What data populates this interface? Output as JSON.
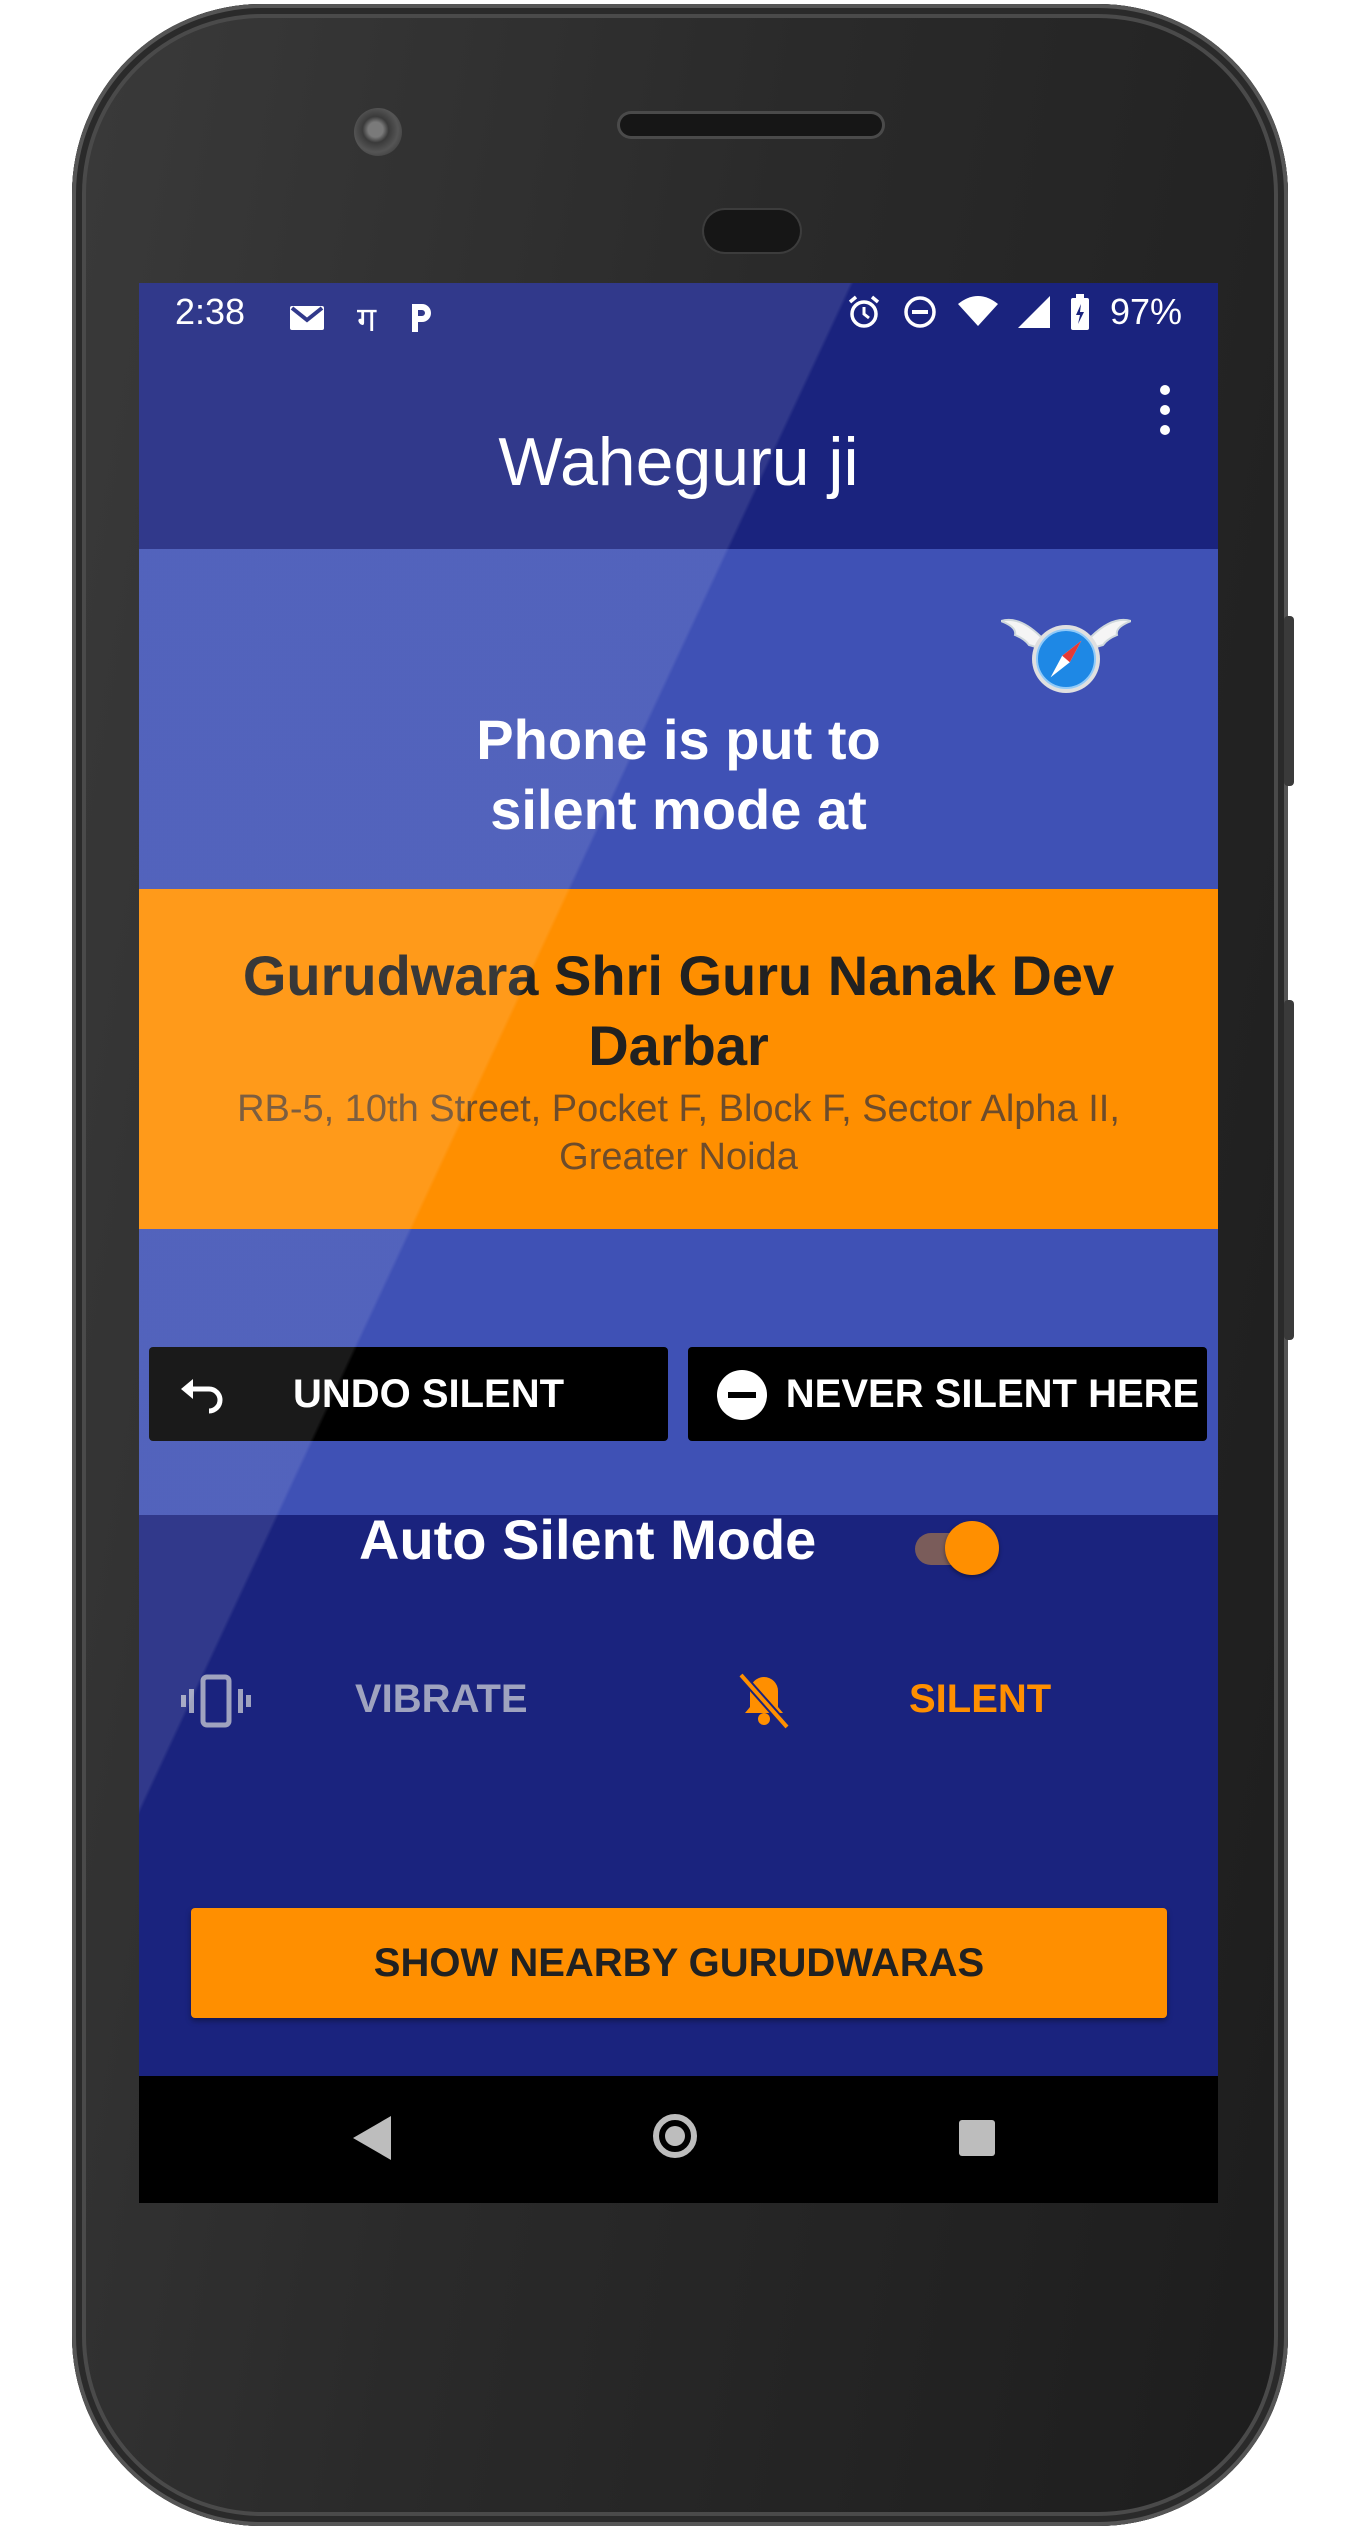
{
  "status_bar": {
    "time": "2:38",
    "devanagari_icon": "ग",
    "battery_percent": "97%",
    "left_icons": [
      "gmail-icon",
      "devanagari-icon",
      "paytm-icon"
    ],
    "right_icons": [
      "alarm-icon",
      "dnd-icon",
      "wifi-icon",
      "signal-icon",
      "battery-charging-icon"
    ]
  },
  "app_bar": {
    "title": "Waheguru ji",
    "menu_icon": "overflow-menu-icon"
  },
  "hero": {
    "message_line1": "Phone is put to",
    "message_line2": "silent mode at",
    "logo_icon": "winged-compass-icon"
  },
  "location": {
    "name_line1": "Gurudwara Shri Guru Nanak Dev",
    "name_line2": "Darbar",
    "address_line1": "RB-5, 10th Street, Pocket F, Block F, Sector Alpha II,",
    "address_line2": "Greater Noida"
  },
  "actions": {
    "undo_label": "UNDO SILENT",
    "never_label": "NEVER SILENT HERE"
  },
  "auto_silent": {
    "label": "Auto Silent Mode",
    "enabled": true
  },
  "modes": {
    "vibrate_label": "VIBRATE",
    "silent_label": "SILENT",
    "selected": "SILENT"
  },
  "nearby_button": {
    "label": "SHOW NEARBY GURUDWARAS"
  },
  "colors": {
    "primary_dark": "#1a237e",
    "primary": "#3f51b5",
    "accent": "#ff8f00"
  }
}
